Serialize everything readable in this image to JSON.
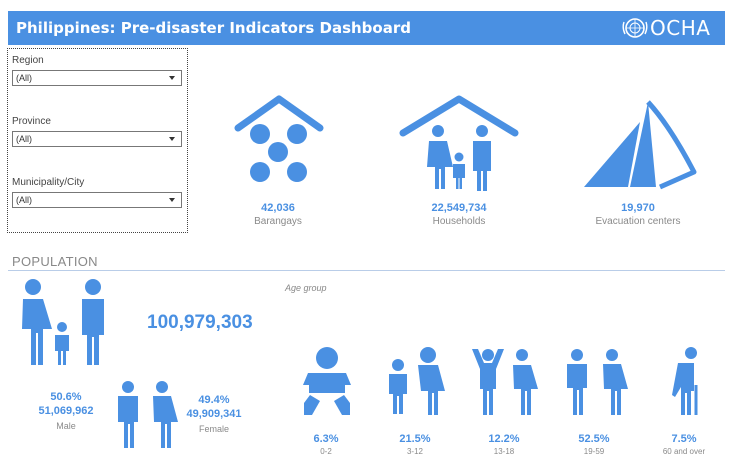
{
  "header": {
    "title": "Philippines: Pre-disaster Indicators Dashboard",
    "logo_text": "OCHA"
  },
  "filters": [
    {
      "label": "Region",
      "value": "(All)"
    },
    {
      "label": "Province",
      "value": "(All)"
    },
    {
      "label": "Municipality/City",
      "value": "(All)"
    }
  ],
  "kpis": [
    {
      "value": "42,036",
      "label": "Barangays",
      "icon": "barangays-icon"
    },
    {
      "value": "22,549,734",
      "label": "Households",
      "icon": "households-icon"
    },
    {
      "value": "19,970",
      "label": "Evacuation centers",
      "icon": "tent-icon"
    }
  ],
  "population": {
    "section_title": "POPULATION",
    "total": "100,979,303",
    "male": {
      "percent": "50.6%",
      "count": "51,069,962",
      "label": "Male"
    },
    "female": {
      "percent": "49.4%",
      "count": "49,909,341",
      "label": "Female"
    },
    "age_heading": "Age group",
    "age_groups": [
      {
        "percent": "6.3%",
        "range": "0-2"
      },
      {
        "percent": "21.5%",
        "range": "3-12"
      },
      {
        "percent": "12.2%",
        "range": "13-18"
      },
      {
        "percent": "52.5%",
        "range": "19-59"
      },
      {
        "percent": "7.5%",
        "range": "60 and over"
      }
    ]
  },
  "colors": {
    "accent": "#4a90e2",
    "label_grey": "#8a8a8a"
  }
}
